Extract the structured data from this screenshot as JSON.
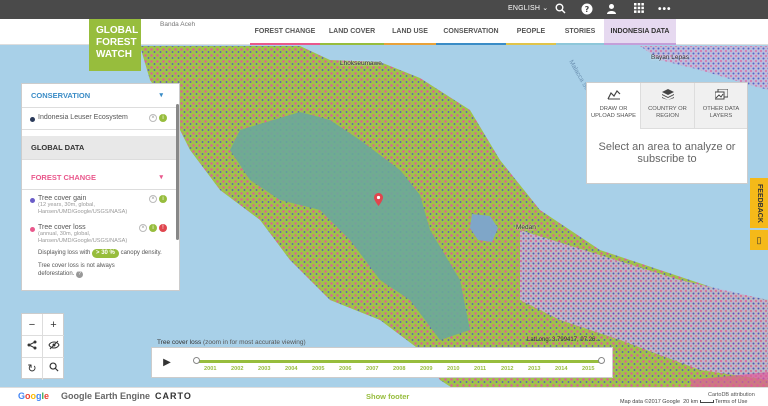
{
  "topbar": {
    "language": "ENGLISH",
    "icons": [
      "search-icon",
      "help-icon",
      "user-icon",
      "apps-icon",
      "more-icon"
    ]
  },
  "logo": {
    "line1": "GLOBAL",
    "line2": "FOREST",
    "line3": "WATCH"
  },
  "nav": {
    "items": [
      {
        "label": "FOREST CHANGE",
        "color": "#e9588c"
      },
      {
        "label": "LAND COVER",
        "color": "#97bd3d"
      },
      {
        "label": "LAND USE",
        "color": "#e8a23a"
      },
      {
        "label": "CONSERVATION",
        "color": "#3a8cc6"
      },
      {
        "label": "PEOPLE",
        "color": "#e0c44a"
      },
      {
        "label": "STORIES",
        "color": "#8ec7d9"
      },
      {
        "label": "INDONESIA DATA",
        "color": "#c49fd9"
      }
    ]
  },
  "panel": {
    "conservation": {
      "title": "CONSERVATION",
      "layer": "Indonesia Leuser Ecosystem"
    },
    "global_data": {
      "title": "GLOBAL DATA"
    },
    "forest_change": {
      "title": "FOREST CHANGE",
      "gain": {
        "label": "Tree cover gain",
        "desc": "(12 years, 30m, global, Hansen/UMD/Google/USGS/NASA)"
      },
      "loss": {
        "label": "Tree cover loss",
        "desc": "(annual, 30m, global, Hansen/UMD/Google/USGS/NASA)",
        "display_prefix": "Displaying loss with",
        "canopy_value": "> 30 %",
        "display_suffix": "canopy density.",
        "note": "Tree cover loss is not always deforestation."
      }
    }
  },
  "analysis": {
    "tabs": [
      {
        "label": "DRAW OR UPLOAD SHAPE",
        "icon": "draw-shape-icon"
      },
      {
        "label": "COUNTRY OR REGION",
        "icon": "layers-icon"
      },
      {
        "label": "OTHER DATA LAYERS",
        "icon": "data-layers-icon"
      }
    ],
    "message": "Select an area to analyze or subscribe to"
  },
  "feedback": {
    "label": "FEEDBACK"
  },
  "timeline": {
    "title": "Tree cover loss",
    "hint": "(zoom in for most accurate viewing)",
    "years": [
      "2001",
      "2002",
      "2003",
      "2004",
      "2005",
      "2006",
      "2007",
      "2008",
      "2009",
      "2010",
      "2011",
      "2012",
      "2013",
      "2014",
      "2015"
    ]
  },
  "latlng": "LatLong: 3.799417, 97.26...",
  "map_labels": {
    "lhokseumawe": "Lhokseumawe",
    "medan": "Medan",
    "bayan_lepas": "Bayan Lepas",
    "banda_aceh": "Banda Aceh",
    "malacca": "Malacca Strait"
  },
  "footer": {
    "google": "Google",
    "earth_engine": "Google Earth Engine",
    "carto": "CARTO",
    "show_footer": "Show footer",
    "attribution": "Map data ©2017 Google",
    "scale": "20 km",
    "terms": "Terms of Use",
    "cartodb": "CartoDB attribution"
  }
}
